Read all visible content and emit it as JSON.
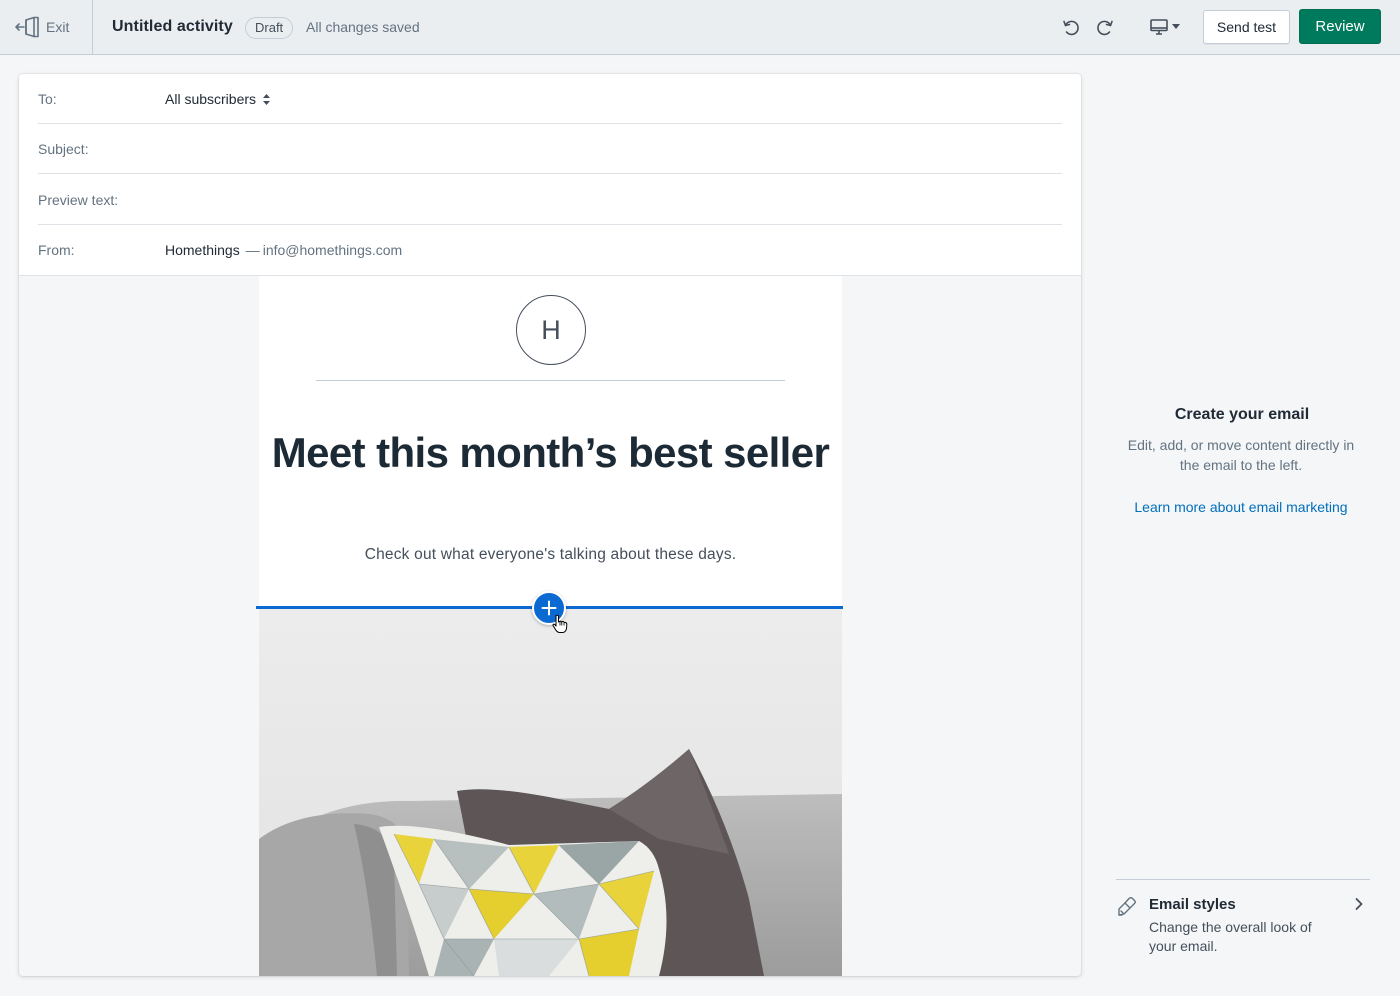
{
  "topbar": {
    "exit_label": "Exit",
    "title": "Untitled activity",
    "status_badge": "Draft",
    "save_status": "All changes saved",
    "send_test_label": "Send test",
    "review_label": "Review"
  },
  "email_header": {
    "to_label": "To:",
    "to_value": "All subscribers",
    "subject_label": "Subject:",
    "subject_value": "",
    "preview_label": "Preview text:",
    "preview_value": "",
    "from_label": "From:",
    "from_name": "Homethings",
    "from_separator": "—",
    "from_email": "info@homethings.com"
  },
  "email_content": {
    "logo_letter": "H",
    "headline": "Meet this month’s best seller",
    "subtext": "Check out what everyone's talking about these days."
  },
  "side_panel": {
    "title": "Create your email",
    "description": "Edit, add, or move content directly in the email to the left.",
    "link_label": "Learn more about email marketing",
    "styles_title": "Email styles",
    "styles_description": "Change the overall look of your email."
  },
  "colors": {
    "primary_action": "#007a5c",
    "insert_accent": "#0b6ad1",
    "link": "#006fbb"
  },
  "icons": [
    "exit-icon",
    "undo-icon",
    "redo-icon",
    "desktop-preview-icon",
    "plus-icon",
    "pointer-hand-icon",
    "paint-brush-icon",
    "chevron-right-icon"
  ]
}
